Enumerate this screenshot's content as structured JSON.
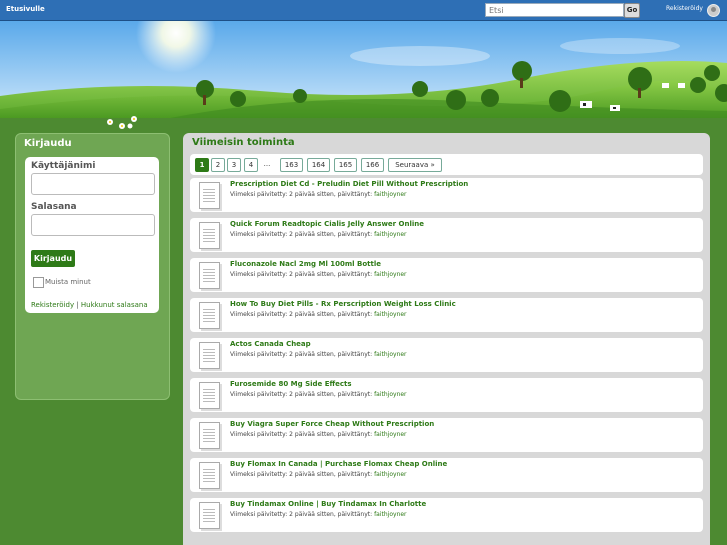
{
  "topbar": {
    "home_link": "Etusivulle",
    "search_placeholder": "Etsi",
    "search_button": "Go",
    "register_link": "Rekisteröidy"
  },
  "sidebar": {
    "title": "Kirjaudu",
    "username_label": "Käyttäjänimi",
    "password_label": "Salasana",
    "login_button": "Kirjaudu",
    "remember_label": "Muista minut",
    "register_link": "Rekisteröidy",
    "separator": " | ",
    "forgot_link": "Hukkunut salasana"
  },
  "main": {
    "title": "Viimeisin toiminta",
    "pager": [
      "1",
      "2",
      "3",
      "4",
      "...",
      "163",
      "164",
      "165",
      "166",
      "Seuraava »"
    ],
    "meta_prefix": "Viimeksi päivitetty: 2 päivää sitten, päivittänyt: ",
    "items": [
      {
        "title": "Prescription Diet Cd - Preludin Diet Pill Without Prescription",
        "author": "faithjoyner"
      },
      {
        "title": "Quick Forum Readtopic Cialis Jelly Answer Online",
        "author": "faithjoyner"
      },
      {
        "title": "Fluconazole Nacl 2mg Ml 100ml Bottle",
        "author": "faithjoyner"
      },
      {
        "title": "How To Buy Diet Pills - Rx Perscription Weight Loss Clinic",
        "author": "faithjoyner"
      },
      {
        "title": "Actos Canada Cheap",
        "author": "faithjoyner"
      },
      {
        "title": "Furosemide 80 Mg Side Effects",
        "author": "faithjoyner"
      },
      {
        "title": "Buy Viagra Super Force Cheap Without Prescription",
        "author": "faithjoyner"
      },
      {
        "title": "Buy Flomax In Canada | Purchase Flomax Cheap Online",
        "author": "faithjoyner"
      },
      {
        "title": "Buy Tindamax Online | Buy Tindamax In Charlotte",
        "author": "faithjoyner"
      }
    ]
  }
}
